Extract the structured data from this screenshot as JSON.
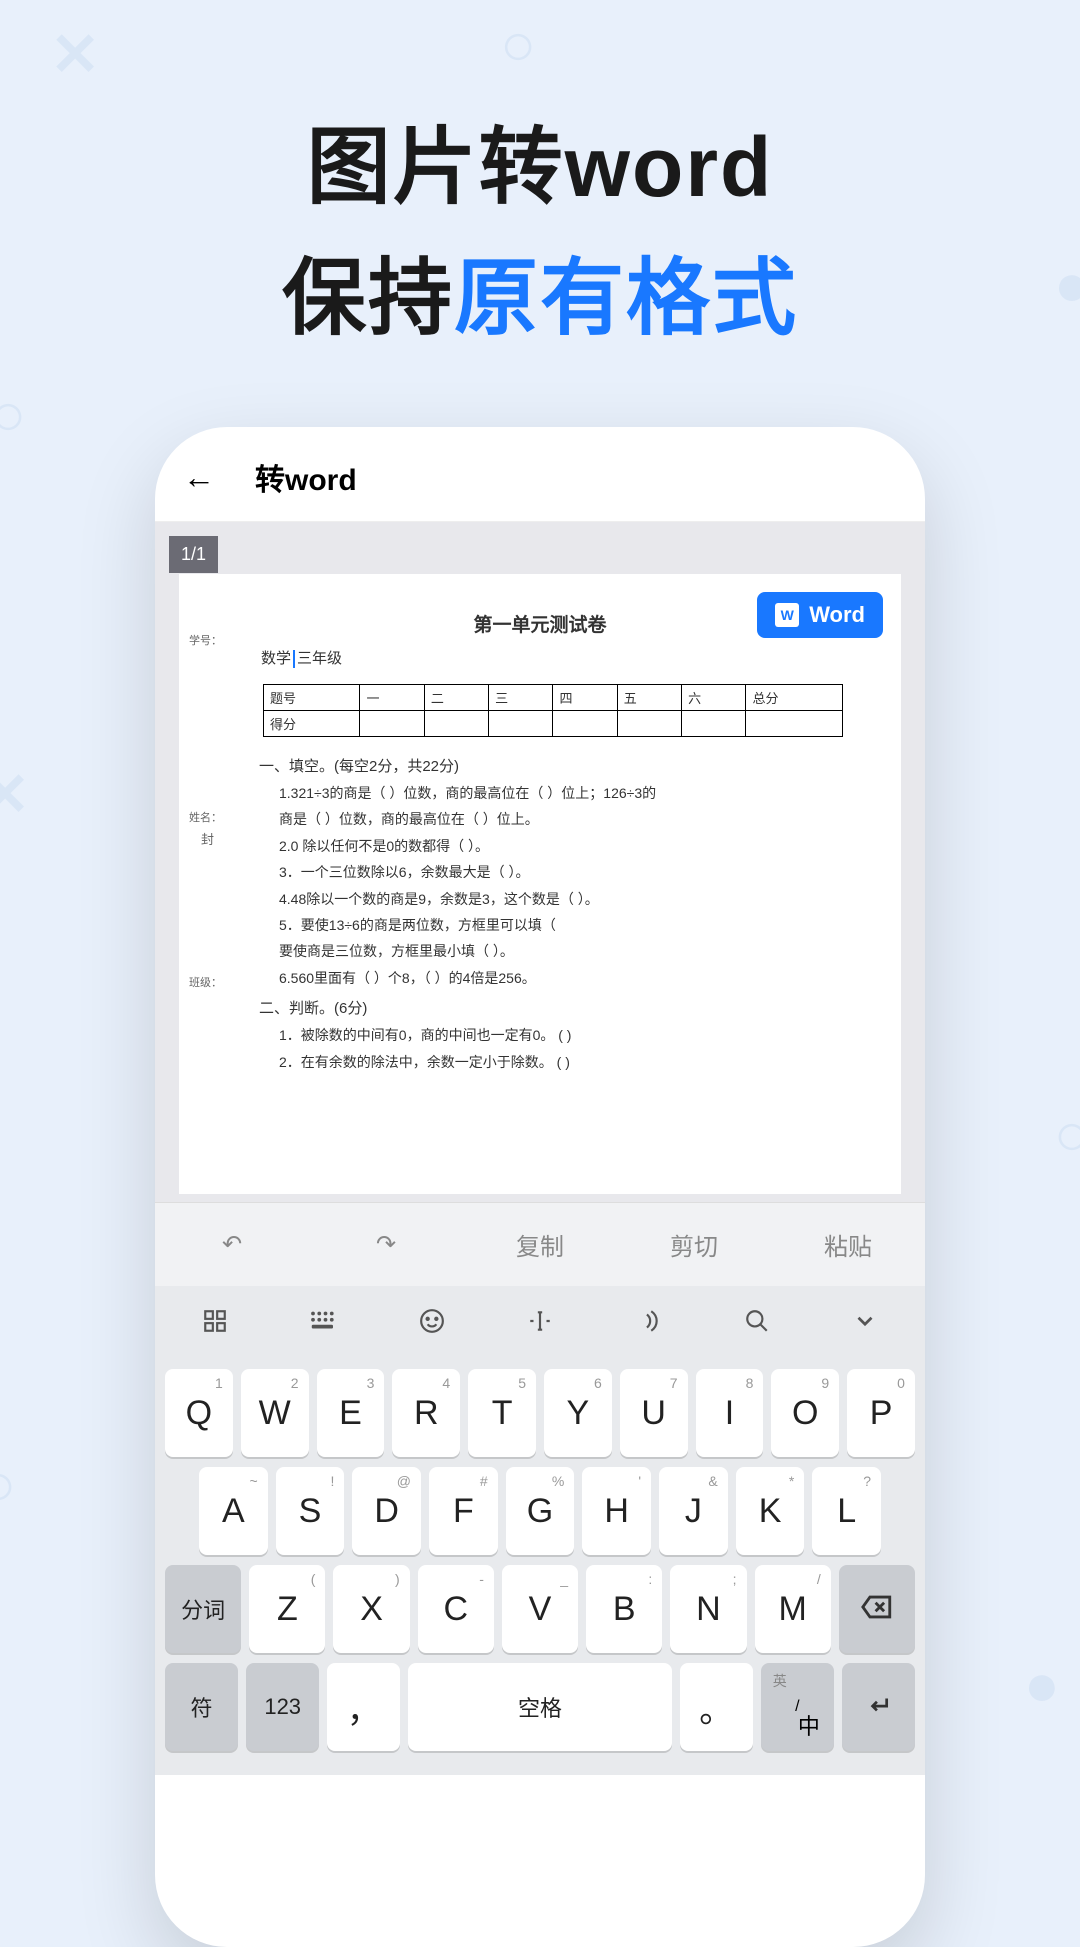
{
  "headline": {
    "line1": "图片转word",
    "line2_prefix": "保持",
    "line2_accent": "原有格式"
  },
  "app": {
    "title": "转word",
    "page_indicator": "1/1",
    "word_button": "Word"
  },
  "document": {
    "title": "第一单元测试卷",
    "meta_label_1": "学号：",
    "meta_label_2": "姓名：",
    "meta_seal": "封",
    "meta_label_3": "班级：",
    "subject_prefix": "数学",
    "subject_suffix": "三年级",
    "table_headers": [
      "题号",
      "一",
      "二",
      "三",
      "四",
      "五",
      "六",
      "总分"
    ],
    "table_row2_label": "得分",
    "section1": "一、填空。(每空2分，共22分)",
    "questions1": [
      "1.321÷3的商是（  ）位数，商的最高位在（ ）位上；126÷3的",
      "商是（  ）位数，商的最高位在（  ）位上。",
      "2.0 除以任何不是0的数都得（   ）。",
      "3．一个三位数除以6，余数最大是（   ）。",
      "4.48除以一个数的商是9，余数是3，这个数是（   ）。",
      "5．要使13÷6的商是两位数，方框里可以填（",
      "要使商是三位数，方框里最小填（   ）。",
      "6.560里面有（   ）个8，（   ）的4倍是256。"
    ],
    "section2": "二、判断。(6分)",
    "questions2": [
      "1．被除数的中间有0，商的中间也一定有0。    (    )",
      "2．在有余数的除法中，余数一定小于除数。    (    )"
    ]
  },
  "edit_toolbar": {
    "undo": "↶",
    "redo": "↷",
    "copy": "复制",
    "cut": "剪切",
    "paste": "粘贴"
  },
  "keyboard": {
    "row1": [
      {
        "main": "Q",
        "alt": "1"
      },
      {
        "main": "W",
        "alt": "2"
      },
      {
        "main": "E",
        "alt": "3"
      },
      {
        "main": "R",
        "alt": "4"
      },
      {
        "main": "T",
        "alt": "5"
      },
      {
        "main": "Y",
        "alt": "6"
      },
      {
        "main": "U",
        "alt": "7"
      },
      {
        "main": "I",
        "alt": "8"
      },
      {
        "main": "O",
        "alt": "9"
      },
      {
        "main": "P",
        "alt": "0"
      }
    ],
    "row2": [
      {
        "main": "A",
        "alt": "~"
      },
      {
        "main": "S",
        "alt": "!"
      },
      {
        "main": "D",
        "alt": "@"
      },
      {
        "main": "F",
        "alt": "#"
      },
      {
        "main": "G",
        "alt": "%"
      },
      {
        "main": "H",
        "alt": "'"
      },
      {
        "main": "J",
        "alt": "&"
      },
      {
        "main": "K",
        "alt": "*"
      },
      {
        "main": "L",
        "alt": "?"
      }
    ],
    "row3_segment": "分词",
    "row3": [
      {
        "main": "Z",
        "alt": "("
      },
      {
        "main": "X",
        "alt": ")"
      },
      {
        "main": "C",
        "alt": "-"
      },
      {
        "main": "V",
        "alt": "_"
      },
      {
        "main": "B",
        "alt": ":"
      },
      {
        "main": "N",
        "alt": ";"
      },
      {
        "main": "M",
        "alt": "/"
      }
    ],
    "row4": {
      "symbol": "符",
      "num": "123",
      "comma": "，",
      "space": "空格",
      "period": "。",
      "lang_sub": "英",
      "lang_main": "中",
      "enter": "↵"
    }
  }
}
